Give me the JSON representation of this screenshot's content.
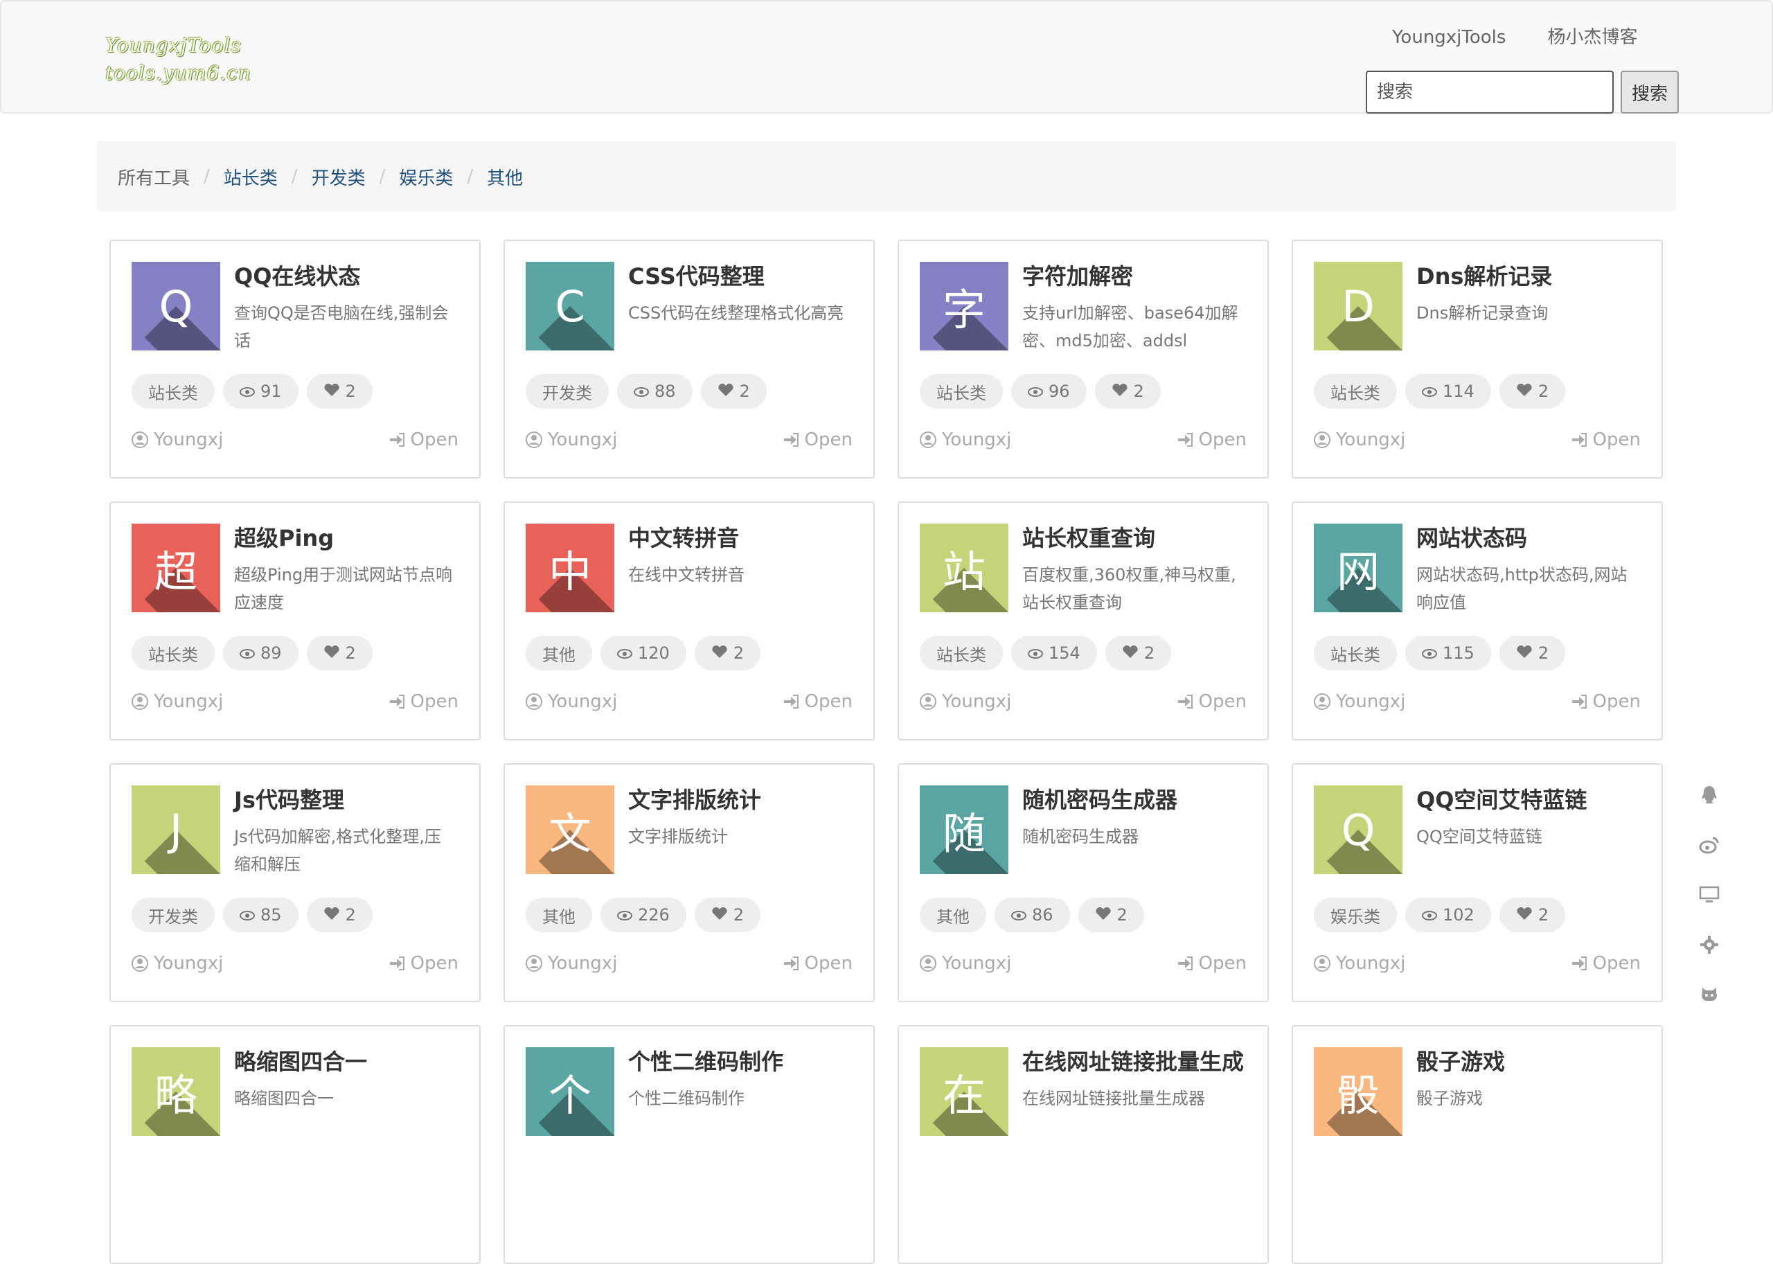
{
  "brand": {
    "line1": "YoungxjTools",
    "line2": "tools.yum6.cn"
  },
  "nav": {
    "links": [
      "YoungxjTools",
      "杨小杰博客"
    ]
  },
  "search": {
    "placeholder": "搜索",
    "button": "搜索"
  },
  "breadcrumb": [
    "所有工具",
    "站长类",
    "开发类",
    "娱乐类",
    "其他"
  ],
  "colors": {
    "purple": "#8581c4",
    "teal": "#5ba5a3",
    "lime": "#c4d478",
    "red": "#e8625a",
    "orange": "#f7b77f"
  },
  "cards": [
    {
      "letter": "Q",
      "color": "#8581c4",
      "title": "QQ在线状态",
      "desc": "查询QQ是否电脑在线,强制会话",
      "category": "站长类",
      "views": "91",
      "likes": "2",
      "author": "Youngxj",
      "open": "Open"
    },
    {
      "letter": "C",
      "color": "#5ba5a3",
      "title": "CSS代码整理",
      "desc": "CSS代码在线整理格式化高亮",
      "category": "开发类",
      "views": "88",
      "likes": "2",
      "author": "Youngxj",
      "open": "Open"
    },
    {
      "letter": "字",
      "color": "#8581c4",
      "title": "字符加解密",
      "desc": "支持url加解密、base64加解密、md5加密、addsl",
      "category": "站长类",
      "views": "96",
      "likes": "2",
      "author": "Youngxj",
      "open": "Open"
    },
    {
      "letter": "D",
      "color": "#c4d478",
      "title": "Dns解析记录",
      "desc": "Dns解析记录查询",
      "category": "站长类",
      "views": "114",
      "likes": "2",
      "author": "Youngxj",
      "open": "Open"
    },
    {
      "letter": "超",
      "color": "#e8625a",
      "title": "超级Ping",
      "desc": "超级Ping用于测试网站节点响应速度",
      "category": "站长类",
      "views": "89",
      "likes": "2",
      "author": "Youngxj",
      "open": "Open"
    },
    {
      "letter": "中",
      "color": "#e8625a",
      "title": "中文转拼音",
      "desc": "在线中文转拼音",
      "category": "其他",
      "views": "120",
      "likes": "2",
      "author": "Youngxj",
      "open": "Open"
    },
    {
      "letter": "站",
      "color": "#c4d478",
      "title": "站长权重查询",
      "desc": "百度权重,360权重,神马权重,站长权重查询",
      "category": "站长类",
      "views": "154",
      "likes": "2",
      "author": "Youngxj",
      "open": "Open"
    },
    {
      "letter": "网",
      "color": "#5ba5a3",
      "title": "网站状态码",
      "desc": "网站状态码,http状态码,网站响应值",
      "category": "站长类",
      "views": "115",
      "likes": "2",
      "author": "Youngxj",
      "open": "Open"
    },
    {
      "letter": "J",
      "color": "#c4d478",
      "title": "Js代码整理",
      "desc": "Js代码加解密,格式化整理,压缩和解压",
      "category": "开发类",
      "views": "85",
      "likes": "2",
      "author": "Youngxj",
      "open": "Open"
    },
    {
      "letter": "文",
      "color": "#f7b77f",
      "title": "文字排版统计",
      "desc": "文字排版统计",
      "category": "其他",
      "views": "226",
      "likes": "2",
      "author": "Youngxj",
      "open": "Open"
    },
    {
      "letter": "随",
      "color": "#5ba5a3",
      "title": "随机密码生成器",
      "desc": "随机密码生成器",
      "category": "其他",
      "views": "86",
      "likes": "2",
      "author": "Youngxj",
      "open": "Open"
    },
    {
      "letter": "Q",
      "color": "#c4d478",
      "title": "QQ空间艾特蓝链",
      "desc": "QQ空间艾特蓝链",
      "category": "娱乐类",
      "views": "102",
      "likes": "2",
      "author": "Youngxj",
      "open": "Open"
    },
    {
      "letter": "略",
      "color": "#c4d478",
      "title": "略缩图四合一",
      "desc": "略缩图四合一",
      "category": "",
      "views": "",
      "likes": "",
      "author": "",
      "open": ""
    },
    {
      "letter": "个",
      "color": "#5ba5a3",
      "title": "个性二维码制作",
      "desc": "个性二维码制作",
      "category": "",
      "views": "",
      "likes": "",
      "author": "",
      "open": ""
    },
    {
      "letter": "在",
      "color": "#c4d478",
      "title": "在线网址链接批量生成",
      "desc": "在线网址链接批量生成器",
      "category": "",
      "views": "",
      "likes": "",
      "author": "",
      "open": ""
    },
    {
      "letter": "骰",
      "color": "#f7b77f",
      "title": "骰子游戏",
      "desc": "骰子游戏",
      "category": "",
      "views": "",
      "likes": "",
      "author": "",
      "open": ""
    }
  ],
  "side_icons": [
    "qq-icon",
    "weibo-icon",
    "monitor-icon",
    "gear-icon",
    "github-icon"
  ]
}
